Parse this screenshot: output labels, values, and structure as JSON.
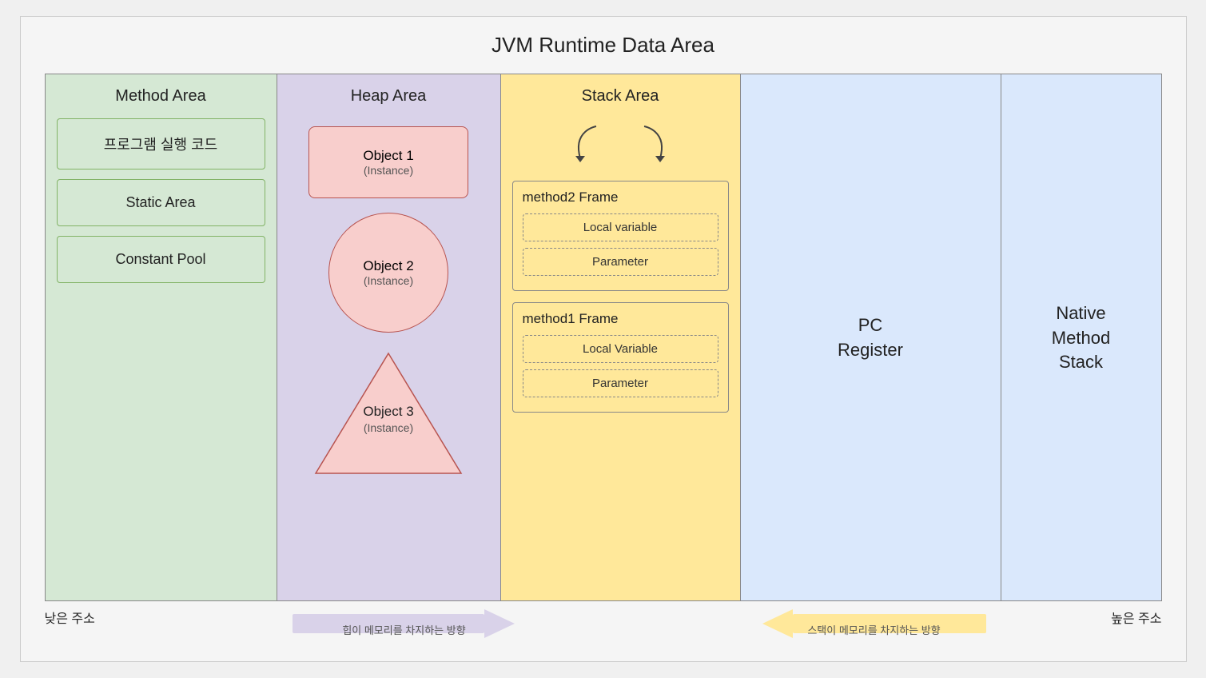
{
  "page": {
    "title": "JVM Runtime Data Area",
    "bg_color": "#f5f5f5"
  },
  "method_area": {
    "title": "Method Area",
    "box1": "프로그램 실행 코드",
    "box2": "Static Area",
    "box3": "Constant Pool"
  },
  "heap_area": {
    "title": "Heap Area",
    "object1_name": "Object 1",
    "object1_sub": "(Instance)",
    "object2_name": "Object 2",
    "object2_sub": "(Instance)",
    "object3_name": "Object 3",
    "object3_sub": "(Instance)"
  },
  "stack_area": {
    "title": "Stack Area",
    "frame2_title": "method2 Frame",
    "frame2_local": "Local variable",
    "frame2_param": "Parameter",
    "frame1_title": "method1 Frame",
    "frame1_local": "Local Variable",
    "frame1_param": "Parameter"
  },
  "pc_register": {
    "title": "PC\nRegister"
  },
  "native_method": {
    "title": "Native\nMethod\nStack"
  },
  "labels": {
    "low_address": "낮은 주소",
    "high_address": "높은 주소",
    "heap_direction": "힙이 메모리를 차지하는 방향",
    "stack_direction": "스택이 메모리를 차지하는 방향"
  }
}
